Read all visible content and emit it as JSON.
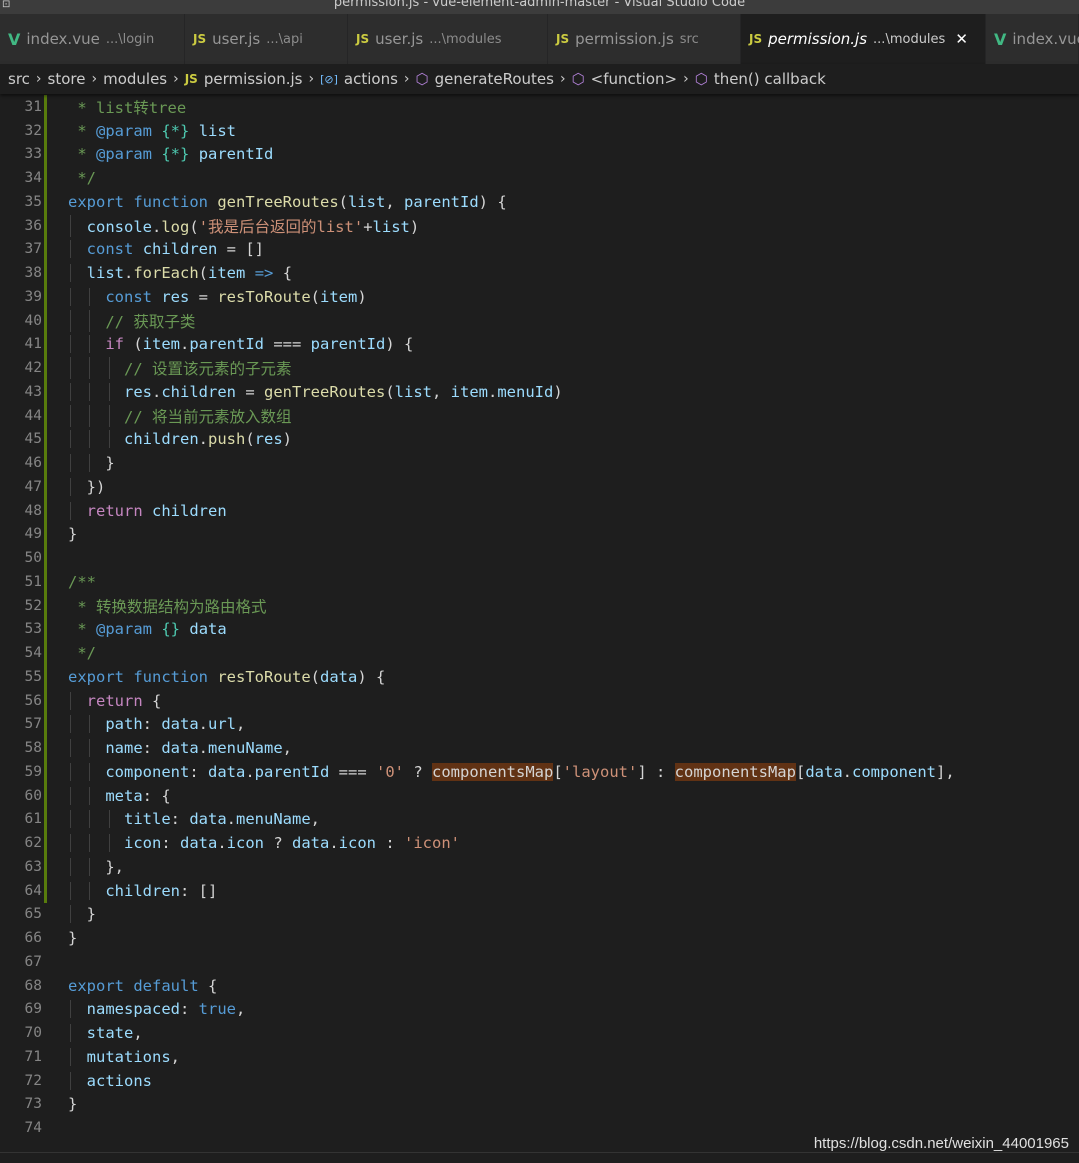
{
  "window": {
    "title": "permission.js - vue-element-admin-master - Visual Studio Code",
    "icon": "window-icon"
  },
  "tabs": [
    {
      "icon": "vue-file-icon",
      "icon_glyph": "V",
      "name": "index.vue",
      "path": "...\\login",
      "active": false
    },
    {
      "icon": "js-file-icon",
      "icon_glyph": "JS",
      "name": "user.js",
      "path": "...\\api",
      "active": false
    },
    {
      "icon": "js-file-icon",
      "icon_glyph": "JS",
      "name": "user.js",
      "path": "...\\modules",
      "active": false
    },
    {
      "icon": "js-file-icon",
      "icon_glyph": "JS",
      "name": "permission.js",
      "path": "src",
      "active": false
    },
    {
      "icon": "js-file-icon",
      "icon_glyph": "JS",
      "name": "permission.js",
      "path": "...\\modules",
      "active": true,
      "close": "✕"
    },
    {
      "icon": "vue-file-icon",
      "icon_glyph": "V",
      "name": "index.vue",
      "path": "",
      "active": false
    }
  ],
  "breadcrumb": [
    {
      "label": "src",
      "icon": ""
    },
    {
      "label": "store",
      "icon": ""
    },
    {
      "label": "modules",
      "icon": ""
    },
    {
      "label": "permission.js",
      "icon": "js-file-icon",
      "glyph": "JS"
    },
    {
      "label": "actions",
      "icon": "variable-icon",
      "glyph": "[⊘]"
    },
    {
      "label": "generateRoutes",
      "icon": "method-icon",
      "glyph": "⬡"
    },
    {
      "label": "<function>",
      "icon": "method-icon",
      "glyph": "⬡"
    },
    {
      "label": "then() callback",
      "icon": "method-icon",
      "glyph": "⬡"
    }
  ],
  "colors": {
    "keyword": "#569cd6",
    "function": "#dcdcaa",
    "variable": "#9cdcfe",
    "string": "#ce9178",
    "comment": "#6a9955",
    "highlight": "#613214",
    "modified_gutter": "#587c0c"
  },
  "code_lines": [
    {
      "n": "31",
      "mod": true,
      "indent": 0,
      "tokens": [
        [
          "cm",
          " * list转tree"
        ]
      ]
    },
    {
      "n": "32",
      "mod": true,
      "indent": 0,
      "tokens": [
        [
          "cm",
          " * "
        ],
        [
          "doc",
          "@param"
        ],
        [
          "cm",
          " "
        ],
        [
          "ty",
          "{*}"
        ],
        [
          "cm",
          " "
        ],
        [
          "var",
          "list"
        ]
      ]
    },
    {
      "n": "33",
      "mod": true,
      "indent": 0,
      "tokens": [
        [
          "cm",
          " * "
        ],
        [
          "doc",
          "@param"
        ],
        [
          "cm",
          " "
        ],
        [
          "ty",
          "{*}"
        ],
        [
          "cm",
          " "
        ],
        [
          "var",
          "parentId"
        ]
      ]
    },
    {
      "n": "34",
      "mod": true,
      "indent": 0,
      "tokens": [
        [
          "cm",
          " */"
        ]
      ]
    },
    {
      "n": "35",
      "mod": true,
      "indent": 0,
      "tokens": [
        [
          "kw",
          "export"
        ],
        [
          "pl",
          " "
        ],
        [
          "kw",
          "function"
        ],
        [
          "pl",
          " "
        ],
        [
          "fn",
          "genTreeRoutes"
        ],
        [
          "pl",
          "("
        ],
        [
          "var",
          "list"
        ],
        [
          "pl",
          ", "
        ],
        [
          "var",
          "parentId"
        ],
        [
          "pl",
          ") {"
        ]
      ]
    },
    {
      "n": "36",
      "mod": true,
      "indent": 1,
      "tokens": [
        [
          "var",
          "console"
        ],
        [
          "pl",
          "."
        ],
        [
          "fn",
          "log"
        ],
        [
          "pl",
          "("
        ],
        [
          "str",
          "'我是后台返回的list'"
        ],
        [
          "pl",
          "+"
        ],
        [
          "var",
          "list"
        ],
        [
          "pl",
          ")"
        ]
      ]
    },
    {
      "n": "37",
      "mod": true,
      "indent": 1,
      "tokens": [
        [
          "kw",
          "const"
        ],
        [
          "pl",
          " "
        ],
        [
          "var",
          "children"
        ],
        [
          "pl",
          " = []"
        ]
      ]
    },
    {
      "n": "38",
      "mod": true,
      "indent": 1,
      "tokens": [
        [
          "var",
          "list"
        ],
        [
          "pl",
          "."
        ],
        [
          "fn",
          "forEach"
        ],
        [
          "pl",
          "("
        ],
        [
          "var",
          "item"
        ],
        [
          "pl",
          " "
        ],
        [
          "kw",
          "=>"
        ],
        [
          "pl",
          " {"
        ]
      ]
    },
    {
      "n": "39",
      "mod": true,
      "indent": 2,
      "tokens": [
        [
          "kw",
          "const"
        ],
        [
          "pl",
          " "
        ],
        [
          "var",
          "res"
        ],
        [
          "pl",
          " = "
        ],
        [
          "fn",
          "resToRoute"
        ],
        [
          "pl",
          "("
        ],
        [
          "var",
          "item"
        ],
        [
          "pl",
          ")"
        ]
      ]
    },
    {
      "n": "40",
      "mod": true,
      "indent": 2,
      "tokens": [
        [
          "cm",
          "// 获取子类"
        ]
      ]
    },
    {
      "n": "41",
      "mod": true,
      "indent": 2,
      "tokens": [
        [
          "ctrl",
          "if"
        ],
        [
          "pl",
          " ("
        ],
        [
          "var",
          "item"
        ],
        [
          "pl",
          "."
        ],
        [
          "var",
          "parentId"
        ],
        [
          "pl",
          " === "
        ],
        [
          "var",
          "parentId"
        ],
        [
          "pl",
          ") {"
        ]
      ]
    },
    {
      "n": "42",
      "mod": true,
      "indent": 3,
      "tokens": [
        [
          "cm",
          "// 设置该元素的子元素"
        ]
      ]
    },
    {
      "n": "43",
      "mod": true,
      "indent": 3,
      "tokens": [
        [
          "var",
          "res"
        ],
        [
          "pl",
          "."
        ],
        [
          "var",
          "children"
        ],
        [
          "pl",
          " = "
        ],
        [
          "fn",
          "genTreeRoutes"
        ],
        [
          "pl",
          "("
        ],
        [
          "var",
          "list"
        ],
        [
          "pl",
          ", "
        ],
        [
          "var",
          "item"
        ],
        [
          "pl",
          "."
        ],
        [
          "var",
          "menuId"
        ],
        [
          "pl",
          ")"
        ]
      ]
    },
    {
      "n": "44",
      "mod": true,
      "indent": 3,
      "tokens": [
        [
          "cm",
          "// 将当前元素放入数组"
        ]
      ]
    },
    {
      "n": "45",
      "mod": true,
      "indent": 3,
      "tokens": [
        [
          "var",
          "children"
        ],
        [
          "pl",
          "."
        ],
        [
          "fn",
          "push"
        ],
        [
          "pl",
          "("
        ],
        [
          "var",
          "res"
        ],
        [
          "pl",
          ")"
        ]
      ]
    },
    {
      "n": "46",
      "mod": true,
      "indent": 2,
      "tokens": [
        [
          "pl",
          "}"
        ]
      ]
    },
    {
      "n": "47",
      "mod": true,
      "indent": 1,
      "tokens": [
        [
          "pl",
          "})"
        ]
      ]
    },
    {
      "n": "48",
      "mod": true,
      "indent": 1,
      "tokens": [
        [
          "ctrl",
          "return"
        ],
        [
          "pl",
          " "
        ],
        [
          "var",
          "children"
        ]
      ]
    },
    {
      "n": "49",
      "mod": true,
      "indent": 0,
      "tokens": [
        [
          "pl",
          "}"
        ]
      ]
    },
    {
      "n": "50",
      "mod": true,
      "indent": 0,
      "tokens": []
    },
    {
      "n": "51",
      "mod": true,
      "indent": 0,
      "tokens": [
        [
          "cm",
          "/**"
        ]
      ]
    },
    {
      "n": "52",
      "mod": true,
      "indent": 0,
      "tokens": [
        [
          "cm",
          " * 转换数据结构为路由格式"
        ]
      ]
    },
    {
      "n": "53",
      "mod": true,
      "indent": 0,
      "tokens": [
        [
          "cm",
          " * "
        ],
        [
          "doc",
          "@param"
        ],
        [
          "cm",
          " "
        ],
        [
          "ty",
          "{}"
        ],
        [
          "cm",
          " "
        ],
        [
          "var",
          "data"
        ]
      ]
    },
    {
      "n": "54",
      "mod": true,
      "indent": 0,
      "tokens": [
        [
          "cm",
          " */"
        ]
      ]
    },
    {
      "n": "55",
      "mod": true,
      "indent": 0,
      "tokens": [
        [
          "kw",
          "export"
        ],
        [
          "pl",
          " "
        ],
        [
          "kw",
          "function"
        ],
        [
          "pl",
          " "
        ],
        [
          "fn",
          "resToRoute"
        ],
        [
          "pl",
          "("
        ],
        [
          "var",
          "data"
        ],
        [
          "pl",
          ") {"
        ]
      ]
    },
    {
      "n": "56",
      "mod": true,
      "indent": 1,
      "tokens": [
        [
          "ctrl",
          "return"
        ],
        [
          "pl",
          " {"
        ]
      ]
    },
    {
      "n": "57",
      "mod": true,
      "indent": 2,
      "tokens": [
        [
          "var",
          "path"
        ],
        [
          "pl",
          ": "
        ],
        [
          "var",
          "data"
        ],
        [
          "pl",
          "."
        ],
        [
          "var",
          "url"
        ],
        [
          "pl",
          ","
        ]
      ]
    },
    {
      "n": "58",
      "mod": true,
      "indent": 2,
      "tokens": [
        [
          "var",
          "name"
        ],
        [
          "pl",
          ": "
        ],
        [
          "var",
          "data"
        ],
        [
          "pl",
          "."
        ],
        [
          "var",
          "menuName"
        ],
        [
          "pl",
          ","
        ]
      ]
    },
    {
      "n": "59",
      "mod": true,
      "indent": 2,
      "tokens": [
        [
          "var",
          "component"
        ],
        [
          "pl",
          ": "
        ],
        [
          "var",
          "data"
        ],
        [
          "pl",
          "."
        ],
        [
          "var",
          "parentId"
        ],
        [
          "pl",
          " === "
        ],
        [
          "str",
          "'0'"
        ],
        [
          "pl",
          " ? "
        ],
        [
          "hl",
          "componentsMap"
        ],
        [
          "pl",
          "["
        ],
        [
          "str",
          "'layout'"
        ],
        [
          "pl",
          "] : "
        ],
        [
          "hl",
          "componentsMap"
        ],
        [
          "pl",
          "["
        ],
        [
          "var",
          "data"
        ],
        [
          "pl",
          "."
        ],
        [
          "var",
          "component"
        ],
        [
          "pl",
          "],"
        ]
      ]
    },
    {
      "n": "60",
      "mod": true,
      "indent": 2,
      "tokens": [
        [
          "var",
          "meta"
        ],
        [
          "pl",
          ": {"
        ]
      ]
    },
    {
      "n": "61",
      "mod": true,
      "indent": 3,
      "tokens": [
        [
          "var",
          "title"
        ],
        [
          "pl",
          ": "
        ],
        [
          "var",
          "data"
        ],
        [
          "pl",
          "."
        ],
        [
          "var",
          "menuName"
        ],
        [
          "pl",
          ","
        ]
      ]
    },
    {
      "n": "62",
      "mod": true,
      "indent": 3,
      "tokens": [
        [
          "var",
          "icon"
        ],
        [
          "pl",
          ": "
        ],
        [
          "var",
          "data"
        ],
        [
          "pl",
          "."
        ],
        [
          "var",
          "icon"
        ],
        [
          "pl",
          " ? "
        ],
        [
          "var",
          "data"
        ],
        [
          "pl",
          "."
        ],
        [
          "var",
          "icon"
        ],
        [
          "pl",
          " : "
        ],
        [
          "str",
          "'icon'"
        ]
      ]
    },
    {
      "n": "63",
      "mod": true,
      "indent": 2,
      "tokens": [
        [
          "pl",
          "},"
        ]
      ]
    },
    {
      "n": "64",
      "mod": true,
      "indent": 2,
      "tokens": [
        [
          "var",
          "children"
        ],
        [
          "pl",
          ": []"
        ]
      ]
    },
    {
      "n": "65",
      "mod": false,
      "indent": 1,
      "tokens": [
        [
          "pl",
          "}"
        ]
      ]
    },
    {
      "n": "66",
      "mod": false,
      "indent": 0,
      "tokens": [
        [
          "pl",
          "}"
        ]
      ]
    },
    {
      "n": "67",
      "mod": false,
      "indent": 0,
      "tokens": []
    },
    {
      "n": "68",
      "mod": false,
      "indent": 0,
      "tokens": [
        [
          "kw",
          "export"
        ],
        [
          "pl",
          " "
        ],
        [
          "kw",
          "default"
        ],
        [
          "pl",
          " {"
        ]
      ]
    },
    {
      "n": "69",
      "mod": false,
      "indent": 1,
      "tokens": [
        [
          "var",
          "namespaced"
        ],
        [
          "pl",
          ": "
        ],
        [
          "bool",
          "true"
        ],
        [
          "pl",
          ","
        ]
      ]
    },
    {
      "n": "70",
      "mod": false,
      "indent": 1,
      "tokens": [
        [
          "var",
          "state"
        ],
        [
          "pl",
          ","
        ]
      ]
    },
    {
      "n": "71",
      "mod": false,
      "indent": 1,
      "tokens": [
        [
          "var",
          "mutations"
        ],
        [
          "pl",
          ","
        ]
      ]
    },
    {
      "n": "72",
      "mod": false,
      "indent": 1,
      "tokens": [
        [
          "var",
          "actions"
        ]
      ]
    },
    {
      "n": "73",
      "mod": false,
      "indent": 0,
      "tokens": [
        [
          "pl",
          "}"
        ]
      ]
    },
    {
      "n": "74",
      "mod": false,
      "indent": 0,
      "tokens": []
    }
  ],
  "watermark": "https://blog.csdn.net/weixin_44001965"
}
